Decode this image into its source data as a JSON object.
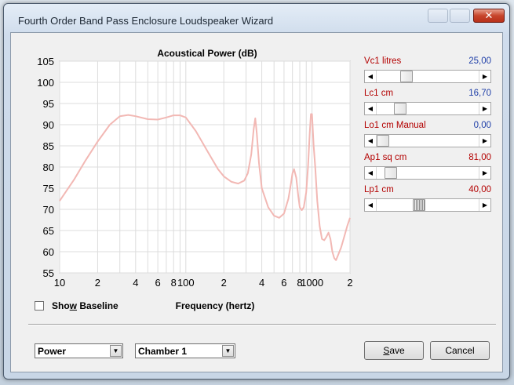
{
  "window": {
    "title": "Fourth Order Band Pass Enclosure Loudspeaker Wizard",
    "close_glyph": "✕"
  },
  "icons": {
    "close": "close-icon",
    "scroll_left": "arrow-left-icon",
    "scroll_right": "arrow-right-icon",
    "dropdown": "chevron-down-icon",
    "checkbox": "checkbox-icon"
  },
  "colors": {
    "curve": "#f2b8b4",
    "grid": "#dcdcdc",
    "param_label": "#b30000",
    "param_value": "#1f3fa8"
  },
  "chart_data": {
    "type": "line",
    "title": "Acoustical Power (dB)",
    "xlabel": "Frequency (hertz)",
    "ylabel": "",
    "x_scale": "log",
    "xlim": [
      10,
      2000
    ],
    "ylim": [
      55,
      105
    ],
    "grid": true,
    "y_ticks": [
      "105",
      "100",
      "95",
      "90",
      "85",
      "80",
      "75",
      "70",
      "65",
      "60",
      "55"
    ],
    "x_ticks": [
      {
        "v": 10,
        "t": "10"
      },
      {
        "v": 20,
        "t": "2"
      },
      {
        "v": 40,
        "t": "4"
      },
      {
        "v": 60,
        "t": "6"
      },
      {
        "v": 80,
        "t": "8"
      },
      {
        "v": 100,
        "t": "100"
      },
      {
        "v": 200,
        "t": "2"
      },
      {
        "v": 400,
        "t": "4"
      },
      {
        "v": 600,
        "t": "6"
      },
      {
        "v": 800,
        "t": "8"
      },
      {
        "v": 1000,
        "t": "1000"
      },
      {
        "v": 2000,
        "t": "2"
      }
    ],
    "series": [
      {
        "x": [
          10,
          13,
          16,
          20,
          25,
          30,
          35,
          40,
          50,
          60,
          70,
          80,
          90,
          100,
          120,
          150,
          180,
          200,
          230,
          260,
          290,
          310,
          330,
          345,
          355,
          365,
          380,
          400,
          450,
          500,
          550,
          600,
          650,
          680,
          700,
          720,
          750,
          780,
          800,
          830,
          860,
          900,
          930,
          960,
          980,
          1000,
          1030,
          1060,
          1100,
          1150,
          1200,
          1250,
          1300,
          1350,
          1400,
          1450,
          1500,
          1550,
          1600,
          1700,
          1800,
          1900,
          2000
        ],
        "y": [
          72,
          77,
          81.5,
          86,
          90,
          92,
          92.3,
          92,
          91.3,
          91.2,
          91.7,
          92.2,
          92.2,
          91.7,
          88.5,
          83.5,
          79.5,
          77.8,
          76.5,
          76.1,
          76.8,
          78.5,
          83,
          89,
          91.5,
          88,
          81,
          75,
          70.5,
          68.5,
          68,
          69,
          72.5,
          76,
          78.5,
          79.5,
          77.5,
          73,
          70.5,
          69.8,
          70.5,
          74,
          80,
          88,
          92.5,
          92.5,
          85,
          80,
          72,
          66,
          63,
          62.7,
          63.5,
          64.5,
          63,
          60,
          58.5,
          58,
          59,
          61,
          63.5,
          66,
          68
        ]
      }
    ]
  },
  "controls": {
    "show_baseline": {
      "pre": "Sho",
      "key": "w",
      "post": " Baseline",
      "checked": false
    }
  },
  "params": [
    {
      "label": "Vc1  litres",
      "value": "25,00",
      "fraction": 0.26
    },
    {
      "label": "Lc1  cm",
      "value": "16,70",
      "fraction": 0.19
    },
    {
      "label": "Lo1  cm  Manual",
      "value": "0,00",
      "fraction": 0.0
    },
    {
      "label": "Ap1  sq cm",
      "value": "81,00",
      "fraction": 0.09
    },
    {
      "label": "Lp1  cm",
      "value": "40,00",
      "fraction": 0.4
    }
  ],
  "selects": {
    "mode": {
      "value": "Power"
    },
    "chamber": {
      "value": "Chamber 1"
    }
  },
  "buttons": {
    "save": {
      "key": "S",
      "rest": "ave"
    },
    "cancel": "Cancel"
  }
}
